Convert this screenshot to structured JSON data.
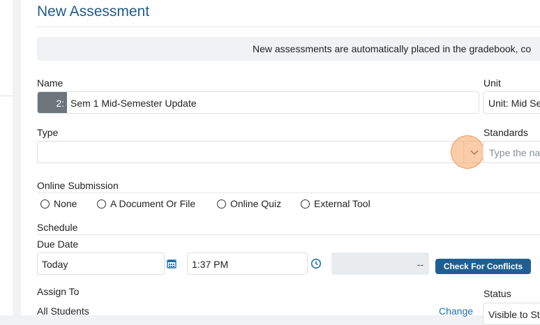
{
  "page": {
    "title": "New Assessment"
  },
  "notice": {
    "text": "New assessments are automatically placed in the gradebook, co"
  },
  "name": {
    "label": "Name",
    "prefix": "2:",
    "value": "Sem 1 Mid-Semester Update"
  },
  "unit": {
    "label": "Unit",
    "value": "Unit: Mid Se"
  },
  "type": {
    "label": "Type",
    "value": ""
  },
  "standards": {
    "label": "Standards",
    "placeholder": "Type the na"
  },
  "online_submission": {
    "label": "Online Submission",
    "options": [
      "None",
      "A Document Or File",
      "Online Quiz",
      "External Tool"
    ]
  },
  "schedule": {
    "label": "Schedule",
    "due_date_label": "Due Date",
    "date_value": "Today",
    "time_value": "1:37 PM",
    "end_value": "--",
    "check_conflicts_label": "Check For Conflicts"
  },
  "assign": {
    "label": "Assign To",
    "value": "All Students",
    "change_label": "Change"
  },
  "status": {
    "label": "Status",
    "value": "Visible to St"
  },
  "colors": {
    "title": "#1f5a8a",
    "primary": "#1e5f92",
    "link": "#1e6fb0",
    "prefix_bg": "#6c757d",
    "focus_marker": "#f4a460"
  },
  "icons": {
    "type_dropdown": "chevron-down-icon",
    "date_picker": "calendar-icon",
    "time_picker": "clock-icon"
  }
}
